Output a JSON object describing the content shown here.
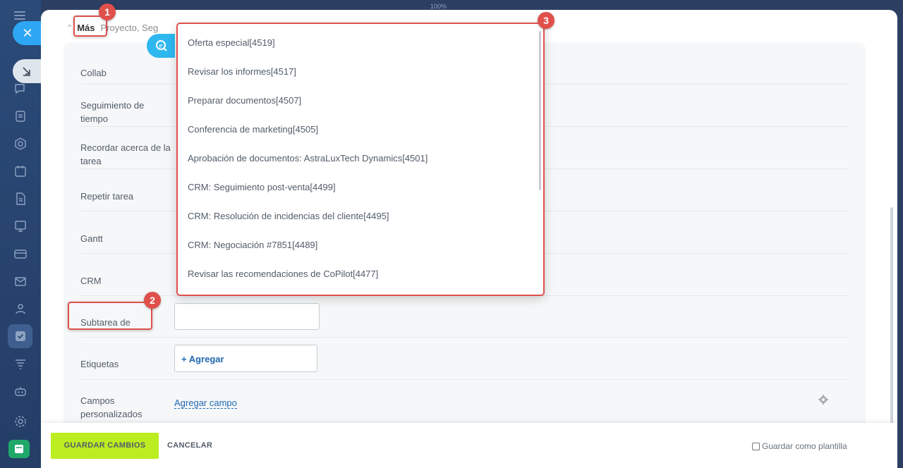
{
  "window": {
    "zoom": "100%"
  },
  "colors": {
    "accent": "#bbed21",
    "link": "#2067b0",
    "callout": "#e0504b",
    "sidebar": "#2b4a78"
  },
  "sidebar": {
    "icons": [
      "hamburger-icon",
      "close-icon",
      "pin-icon",
      "chat-icon",
      "feed-icon",
      "hex-icon",
      "calendar-icon",
      "document-icon",
      "board-icon",
      "card-icon",
      "mail-icon",
      "people-icon",
      "tasks-icon",
      "filter-icon",
      "robot-icon",
      "settings-icon",
      "app-icon"
    ]
  },
  "more": {
    "label": "Más",
    "extra": "Proyecto,  Seg"
  },
  "fields": [
    {
      "label": "Collab"
    },
    {
      "label": "Seguimiento de tiempo"
    },
    {
      "label": "Recordar acerca de la tarea"
    },
    {
      "label": "Repetir tarea"
    },
    {
      "label": "Gantt"
    },
    {
      "label": "CRM"
    },
    {
      "label": "Subtarea de"
    },
    {
      "label": "Etiquetas"
    },
    {
      "label": "Campos personalizados"
    }
  ],
  "tags": {
    "add_label": "+ Agregar"
  },
  "custom_fields": {
    "add_link": "Agregar campo"
  },
  "dropdown": {
    "items": [
      "Oferta especial[4519]",
      "Revisar los informes[4517]",
      "Preparar documentos[4507]",
      "Conferencia de marketing[4505]",
      "Aprobación de documentos: AstraLuxTech Dynamics[4501]",
      "CRM: Seguimiento post-venta[4499]",
      "CRM: Resolución de incidencias del cliente[4495]",
      "CRM: Negociación #7851[4489]",
      "Revisar las recomendaciones de CoPilot[4477]"
    ]
  },
  "footer": {
    "save": "GUARDAR CAMBIOS",
    "cancel": "CANCELAR",
    "template": "Guardar como plantilla"
  },
  "callouts": [
    "1",
    "2",
    "3"
  ]
}
